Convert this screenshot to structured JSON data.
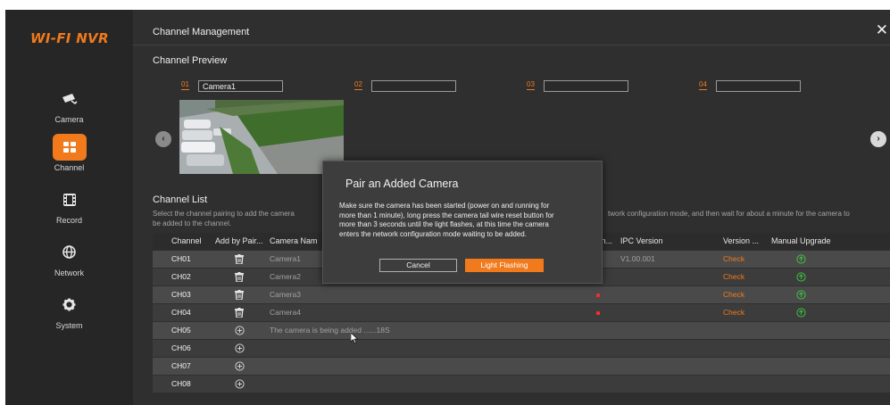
{
  "logo": "WI-FI NVR",
  "sidebar": {
    "items": [
      {
        "label": "Camera",
        "icon": "camera-icon",
        "active": false
      },
      {
        "label": "Channel",
        "icon": "channel-grid-icon",
        "active": true
      },
      {
        "label": "Record",
        "icon": "film-icon",
        "active": false
      },
      {
        "label": "Network",
        "icon": "globe-icon",
        "active": false
      },
      {
        "label": "System",
        "icon": "gear-icon",
        "active": false
      }
    ]
  },
  "header": {
    "title": "Channel Management",
    "close": "✕"
  },
  "preview": {
    "title": "Channel Preview",
    "slots": [
      {
        "num": "01",
        "value": "Camera1"
      },
      {
        "num": "02",
        "value": ""
      },
      {
        "num": "03",
        "value": ""
      },
      {
        "num": "04",
        "value": ""
      }
    ]
  },
  "channel_list": {
    "title": "Channel List",
    "description": "Select the channel pairing to add the camera, ... work configuration mode, and then wait for about a minute for the camera to be added to the channel.",
    "description_left": "Select the channel pairing to add the camera",
    "description_right": "twork configuration mode, and then wait for about a minute for the camera to",
    "description_line2": "be added to the channel.",
    "columns": [
      "Channel",
      "Add by Pair...",
      "Camera Nam",
      "In...",
      "IPC Version",
      "Version ...",
      "Manual Upgrade"
    ],
    "rows": [
      {
        "channel": "CH01",
        "name": "Camera1",
        "ipc": "V1.00.001",
        "version": "Check",
        "added": true
      },
      {
        "channel": "CH02",
        "name": "Camera2",
        "ipc": "",
        "version": "Check",
        "added": true
      },
      {
        "channel": "CH03",
        "name": "Camera3",
        "ipc": "",
        "version": "Check",
        "added": true
      },
      {
        "channel": "CH04",
        "name": "Camera4",
        "ipc": "",
        "version": "Check",
        "added": true
      },
      {
        "channel": "CH05",
        "name": "The camera is being added ......18S",
        "ipc": "",
        "version": "",
        "added": false
      },
      {
        "channel": "CH06",
        "name": "",
        "ipc": "",
        "version": "",
        "added": false
      },
      {
        "channel": "CH07",
        "name": "",
        "ipc": "",
        "version": "",
        "added": false
      },
      {
        "channel": "CH08",
        "name": "",
        "ipc": "",
        "version": "",
        "added": false
      }
    ]
  },
  "modal": {
    "title": "Pair an Added Camera",
    "body": "Make sure the camera has been started (power on and running for more than 1 minute), long press the camera tail wire reset button for more than 3 seconds until the light flashes, at this time the camera enters the network configuration mode waiting to be added.",
    "cancel": "Cancel",
    "confirm": "Light Flashing"
  },
  "colors": {
    "accent": "#f07a1c",
    "upgrade": "#3fbf3f",
    "alert": "#ff2a2a"
  }
}
